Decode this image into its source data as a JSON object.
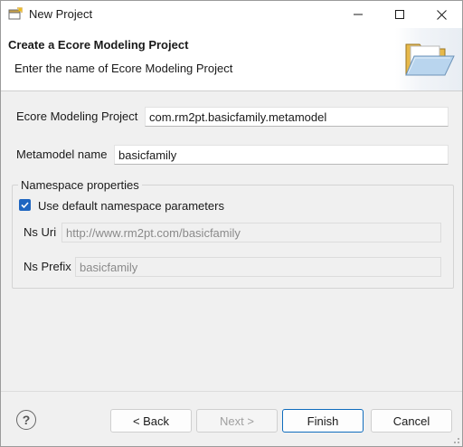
{
  "window": {
    "title": "New Project",
    "icon": "eclipse-project-icon"
  },
  "banner": {
    "title": "Create a Ecore Modeling Project",
    "subtitle": "Enter the name of Ecore Modeling Project",
    "icon": "open-folder-icon"
  },
  "form": {
    "project_label": "Ecore Modeling Project",
    "project_value": "com.rm2pt.basicfamily.metamodel",
    "metamodel_label": "Metamodel name",
    "metamodel_value": "basicfamily"
  },
  "namespace": {
    "legend": "Namespace properties",
    "use_default_label": "Use default namespace parameters",
    "use_default_checked": true,
    "ns_uri_label": "Ns Uri",
    "ns_uri_value": "http://www.rm2pt.com/basicfamily",
    "ns_prefix_label": "Ns Prefix",
    "ns_prefix_value": "basicfamily"
  },
  "footer": {
    "help_symbol": "?",
    "back_label": "< Back",
    "next_label": "Next >",
    "finish_label": "Finish",
    "cancel_label": "Cancel"
  },
  "colors": {
    "accent": "#1f66c1",
    "default_button_border": "#0f6cbd"
  }
}
